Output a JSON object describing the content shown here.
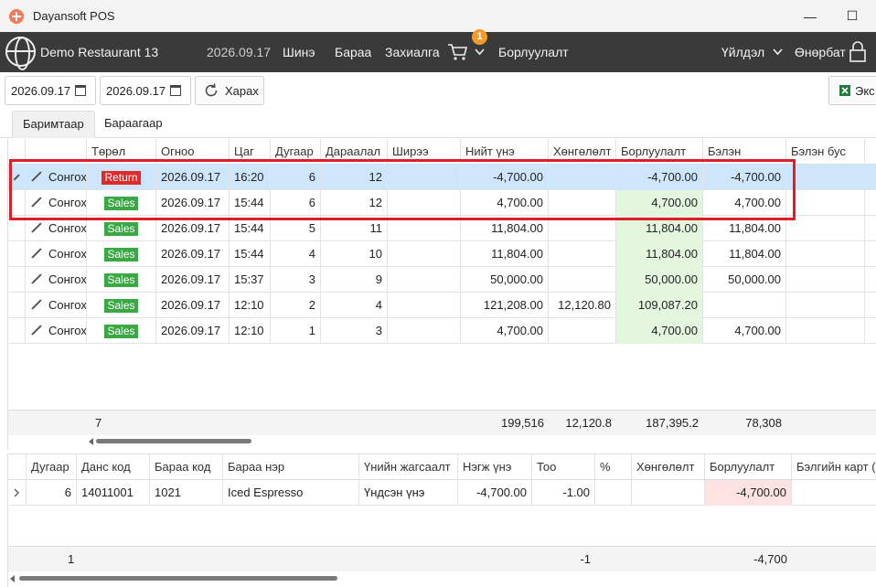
{
  "window": {
    "title": "Dayansoft POS",
    "minimize": "—",
    "maximize": "☐"
  },
  "nav": {
    "restaurant": "Demo Restaurant 13",
    "date": "2026.09.17",
    "new": "Шинэ",
    "products": "Бараа",
    "orders": "Захиалга",
    "cart_badge": "1",
    "sales": "Борлуулалт",
    "operations": "Үйлдэл",
    "user": "Өнөрбат"
  },
  "toolbar": {
    "date_from": "2026.09.17",
    "date_to": "2026.09.17",
    "search_label": "Харах",
    "export_label": "Экс"
  },
  "tabs": {
    "by_document": "Баримтаар",
    "by_product": "Бараагаар"
  },
  "main_grid": {
    "headers": {
      "type": "Төрөл",
      "date": "Огноо",
      "time": "Цаг",
      "number": "Дугаар",
      "sequence": "Дараалал",
      "table": "Ширээ",
      "total": "Нийт үнэ",
      "discount": "Хөнгөлөлт",
      "sales": "Борлуулалт",
      "cash": "Бэлэн",
      "noncash": "Бэлэн бус"
    },
    "select_label": "Сонгох",
    "rows": [
      {
        "type": "Return",
        "date": "2026.09.17",
        "time": "16:20",
        "number": "6",
        "sequence": "12",
        "total": "-4,700.00",
        "discount": "",
        "sales": "-4,700.00",
        "cash": "-4,700.00"
      },
      {
        "type": "Sales",
        "date": "2026.09.17",
        "time": "15:44",
        "number": "6",
        "sequence": "12",
        "total": "4,700.00",
        "discount": "",
        "sales": "4,700.00",
        "cash": "4,700.00"
      },
      {
        "type": "Sales",
        "date": "2026.09.17",
        "time": "15:44",
        "number": "5",
        "sequence": "11",
        "total": "11,804.00",
        "discount": "",
        "sales": "11,804.00",
        "cash": "11,804.00"
      },
      {
        "type": "Sales",
        "date": "2026.09.17",
        "time": "15:44",
        "number": "4",
        "sequence": "10",
        "total": "11,804.00",
        "discount": "",
        "sales": "11,804.00",
        "cash": "11,804.00"
      },
      {
        "type": "Sales",
        "date": "2026.09.17",
        "time": "15:37",
        "number": "3",
        "sequence": "9",
        "total": "50,000.00",
        "discount": "",
        "sales": "50,000.00",
        "cash": "50,000.00"
      },
      {
        "type": "Sales",
        "date": "2026.09.17",
        "time": "12:10",
        "number": "2",
        "sequence": "4",
        "total": "121,208.00",
        "discount": "12,120.80",
        "sales": "109,087.20",
        "cash": ""
      },
      {
        "type": "Sales",
        "date": "2026.09.17",
        "time": "12:10",
        "number": "1",
        "sequence": "3",
        "total": "4,700.00",
        "discount": "",
        "sales": "4,700.00",
        "cash": "4,700.00"
      }
    ],
    "footer": {
      "count": "7",
      "total": "199,516",
      "discount": "12,120.8",
      "sales": "187,395.2",
      "cash": "78,308"
    }
  },
  "detail_grid": {
    "headers": {
      "number": "Дугаар",
      "account": "Данс код",
      "product_code": "Бараа код",
      "product_name": "Бараа нэр",
      "price_list": "Үнийн жагсаалт",
      "unit_price": "Нэгж үнэ",
      "qty": "Тоо",
      "percent": "%",
      "discount": "Хөнгөлөлт",
      "sales": "Борлуулалт",
      "gift_card": "Бэлгийн карт ("
    },
    "rows": [
      {
        "number": "6",
        "account": "14011001",
        "product_code": "1021",
        "product_name": "Iced Espresso",
        "price_list": "Үндсэн үнэ",
        "unit_price": "-4,700.00",
        "qty": "-1.00",
        "percent": "",
        "discount": "",
        "sales": "-4,700.00"
      }
    ],
    "footer": {
      "count": "1",
      "qty": "-1",
      "sales": "-4,700"
    }
  }
}
